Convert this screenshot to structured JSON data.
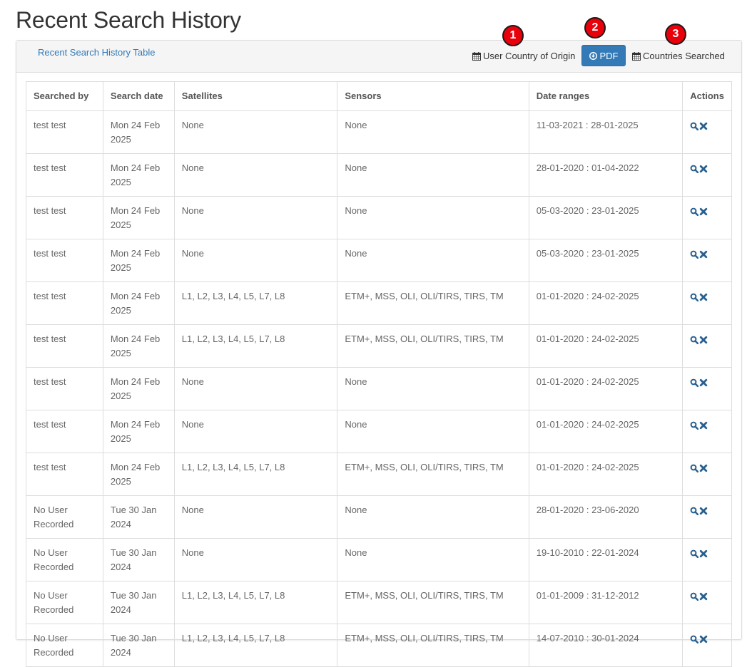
{
  "page": {
    "title": "Recent Search History"
  },
  "panel": {
    "tab_label": "Recent Search History Table",
    "toolbar": {
      "user_country_label": "User Country of Origin",
      "pdf_label": "PDF",
      "countries_label": "Countries Searched"
    },
    "markers": [
      "1",
      "2",
      "3"
    ]
  },
  "table": {
    "headers": [
      "Searched by",
      "Search date",
      "Satellites",
      "Sensors",
      "Date ranges",
      "Actions"
    ],
    "rows": [
      {
        "by": "test test",
        "date": "Mon 24 Feb 2025",
        "satellites": "None",
        "sensors": "None",
        "range": "11-03-2021 : 28-01-2025"
      },
      {
        "by": "test test",
        "date": "Mon 24 Feb 2025",
        "satellites": "None",
        "sensors": "None",
        "range": "28-01-2020 : 01-04-2022"
      },
      {
        "by": "test test",
        "date": "Mon 24 Feb 2025",
        "satellites": "None",
        "sensors": "None",
        "range": "05-03-2020 : 23-01-2025"
      },
      {
        "by": "test test",
        "date": "Mon 24 Feb 2025",
        "satellites": "None",
        "sensors": "None",
        "range": "05-03-2020 : 23-01-2025"
      },
      {
        "by": "test test",
        "date": "Mon 24 Feb 2025",
        "satellites": "L1, L2, L3, L4, L5, L7, L8",
        "sensors": "ETM+, MSS, OLI, OLI/TIRS, TIRS, TM",
        "range": "01-01-2020 : 24-02-2025"
      },
      {
        "by": "test test",
        "date": "Mon 24 Feb 2025",
        "satellites": "L1, L2, L3, L4, L5, L7, L8",
        "sensors": "ETM+, MSS, OLI, OLI/TIRS, TIRS, TM",
        "range": "01-01-2020 : 24-02-2025"
      },
      {
        "by": "test test",
        "date": "Mon 24 Feb 2025",
        "satellites": "None",
        "sensors": "None",
        "range": "01-01-2020 : 24-02-2025"
      },
      {
        "by": "test test",
        "date": "Mon 24 Feb 2025",
        "satellites": "None",
        "sensors": "None",
        "range": "01-01-2020 : 24-02-2025"
      },
      {
        "by": "test test",
        "date": "Mon 24 Feb 2025",
        "satellites": "L1, L2, L3, L4, L5, L7, L8",
        "sensors": "ETM+, MSS, OLI, OLI/TIRS, TIRS, TM",
        "range": "01-01-2020 : 24-02-2025"
      },
      {
        "by": "No User Recorded",
        "date": "Tue 30 Jan 2024",
        "satellites": "None",
        "sensors": "None",
        "range": "28-01-2020 : 23-06-2020"
      },
      {
        "by": "No User Recorded",
        "date": "Tue 30 Jan 2024",
        "satellites": "None",
        "sensors": "None",
        "range": "19-10-2010 : 22-01-2024"
      },
      {
        "by": "No User Recorded",
        "date": "Tue 30 Jan 2024",
        "satellites": "L1, L2, L3, L4, L5, L7, L8",
        "sensors": "ETM+, MSS, OLI, OLI/TIRS, TIRS, TM",
        "range": "01-01-2009 : 31-12-2012"
      },
      {
        "by": "No User Recorded",
        "date": "Tue 30 Jan 2024",
        "satellites": "L1, L2, L3, L4, L5, L7, L8",
        "sensors": "ETM+, MSS, OLI, OLI/TIRS, TIRS, TM",
        "range": "14-07-2010 : 30-01-2024"
      }
    ],
    "action_icons": [
      "search-icon",
      "remove-icon"
    ]
  },
  "colors": {
    "accent": "#337ab7",
    "marker": "#e8000b",
    "text": "#555555"
  }
}
